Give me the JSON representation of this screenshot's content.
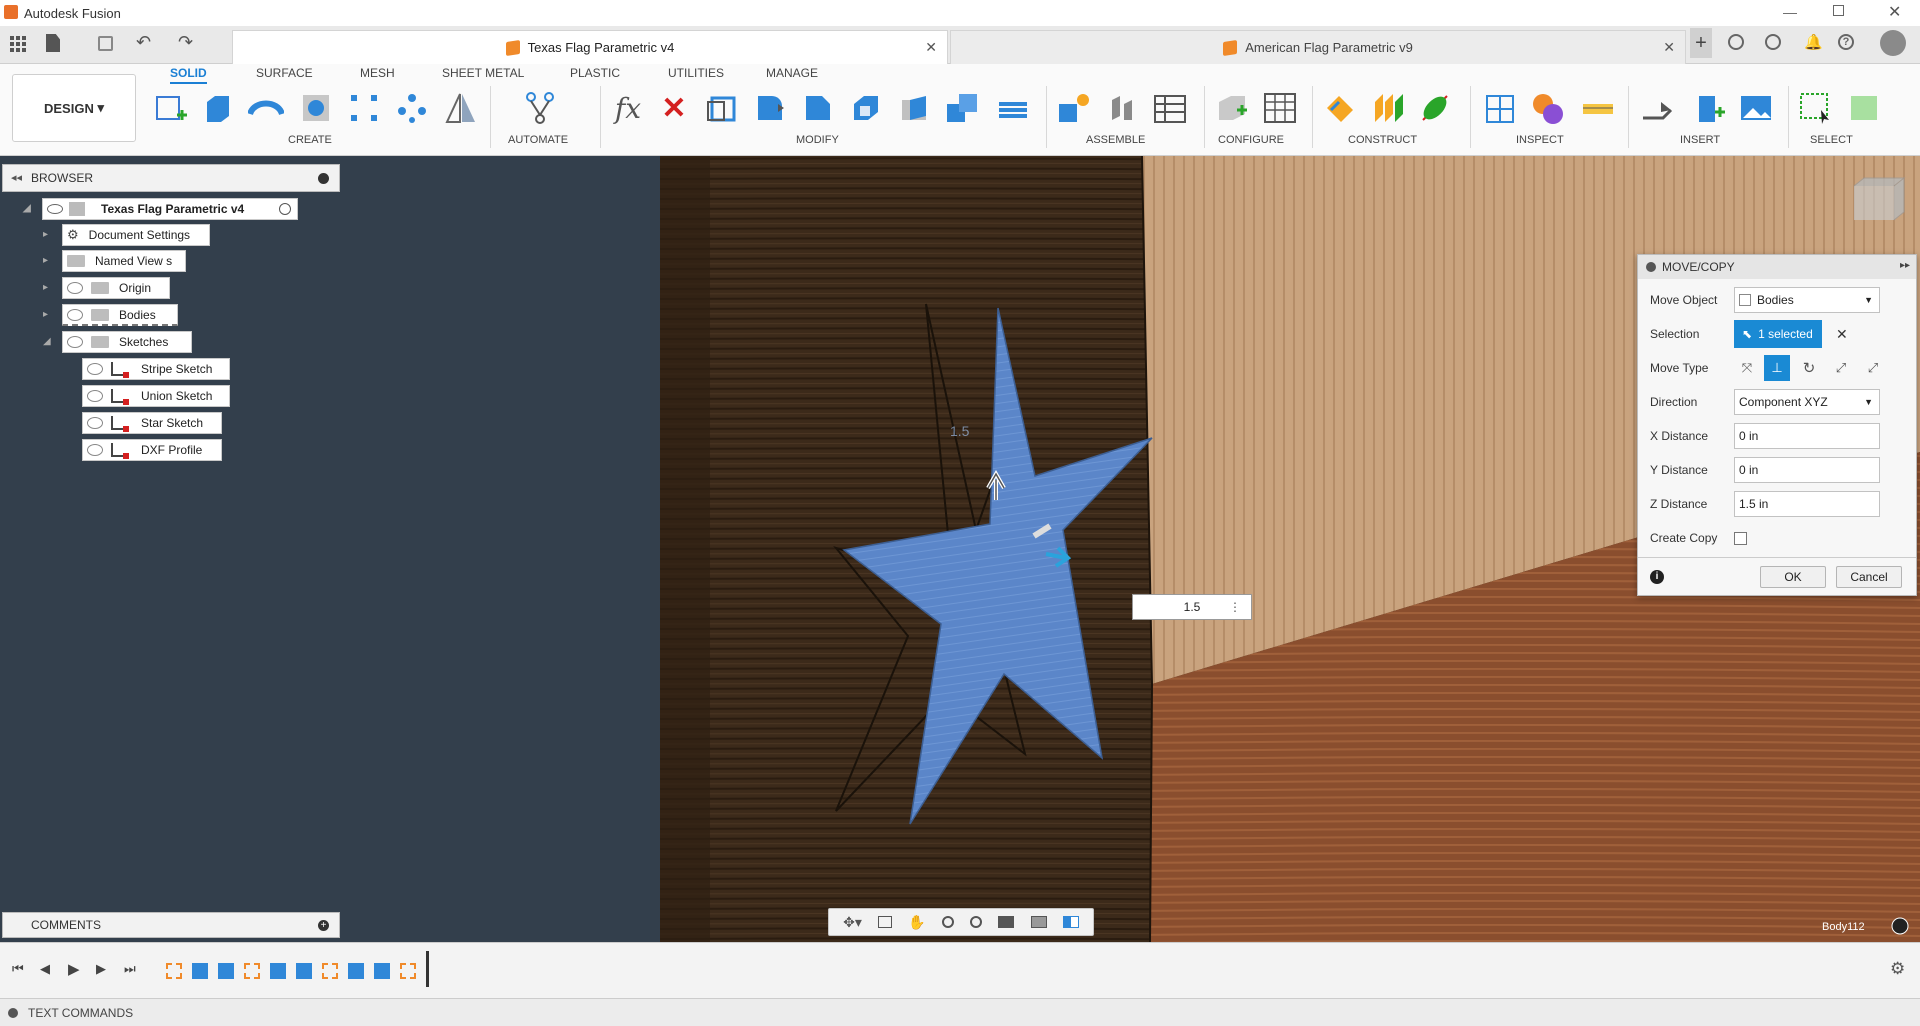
{
  "app": {
    "title": "Autodesk Fusion"
  },
  "tabs": [
    {
      "label": "Texas Flag Parametric v4",
      "active": true
    },
    {
      "label": "American Flag Parametric v9",
      "active": false
    }
  ],
  "ribbon": {
    "workspace": "DESIGN",
    "tabs": [
      "SOLID",
      "SURFACE",
      "MESH",
      "SHEET METAL",
      "PLASTIC",
      "UTILITIES",
      "MANAGE"
    ],
    "groups": [
      "CREATE",
      "AUTOMATE",
      "MODIFY",
      "ASSEMBLE",
      "CONFIGURE",
      "CONSTRUCT",
      "INSPECT",
      "INSERT",
      "SELECT"
    ]
  },
  "browser": {
    "title": "BROWSER",
    "root": "Texas Flag Parametric v4",
    "items": [
      "Document Settings",
      "Named View s",
      "Origin",
      "Bodies",
      "Sketches"
    ],
    "sketches": [
      "Stripe Sketch",
      "Union Sketch",
      "Star Sketch",
      "DXF Profile"
    ]
  },
  "comments": {
    "title": "COMMENTS"
  },
  "textcommands": {
    "title": "TEXT COMMANDS"
  },
  "dialog": {
    "title": "MOVE/COPY",
    "move_object_label": "Move Object",
    "move_object_value": "Bodies",
    "selection_label": "Selection",
    "selection_value": "1 selected",
    "move_type_label": "Move Type",
    "direction_label": "Direction",
    "direction_value": "Component XYZ",
    "x_label": "X Distance",
    "x_value": "0 in",
    "y_label": "Y Distance",
    "y_value": "0 in",
    "z_label": "Z Distance",
    "z_value": "1.5 in",
    "copy_label": "Create Copy",
    "ok": "OK",
    "cancel": "Cancel"
  },
  "viewport": {
    "input_value": "1.5",
    "dim_label": "1.5",
    "body_label": "Body112"
  },
  "colors": {
    "accent": "#1a7fd4",
    "star": "#5b86c9",
    "panel": "#333f4c"
  }
}
